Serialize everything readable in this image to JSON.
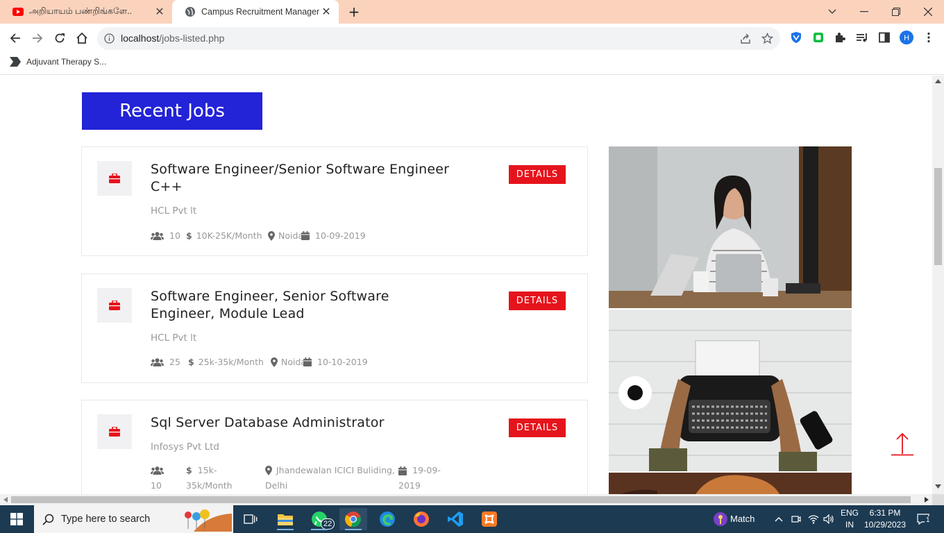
{
  "browser": {
    "tabs": [
      {
        "title": "அறியாயம் பண்றிங்களே..",
        "favicon": "youtube-icon",
        "active": false
      },
      {
        "title": "Campus Recruitment Management",
        "favicon": "globe-icon",
        "active": true
      }
    ],
    "new_tab": "+",
    "url_host": "localhost",
    "url_path": "/jobs-listed.php",
    "bookmark": "Adjuvant Therapy S..."
  },
  "page": {
    "heading": "Recent Jobs",
    "details_label": "DETAILS",
    "jobs": [
      {
        "title": "Software Engineer/Senior Software Engineer C++",
        "company": "HCL Pvt lt",
        "openings": "10",
        "salary": "10K-25K/Month",
        "location": "Noida",
        "date": "10-09-2019"
      },
      {
        "title": "Software Engineer, Senior Software Engineer, Module Lead",
        "company": "HCL Pvt lt",
        "openings": "25",
        "salary": "25k-35k/Month",
        "location": "Noida",
        "date": "10-10-2019"
      },
      {
        "title": "Sql Server Database Administrator",
        "company": "Infosys Pvt Ltd",
        "openings": "10",
        "salary_line1": "15k-",
        "salary_line2": "35k/Month",
        "location_line1": "Jhandewalan ICICI Buliding,",
        "location_line2": "Delhi",
        "date_line1": "19-09-",
        "date_line2": "2019"
      }
    ]
  },
  "taskbar": {
    "search_placeholder": "Type here to search",
    "whatsapp_badge": "22",
    "match_label": "Match",
    "lang_line1": "ENG",
    "lang_line2": "IN",
    "time": "6:31 PM",
    "date": "10/29/2023",
    "notifications": "1"
  },
  "colors": {
    "accent_blue": "#2323d8",
    "details_red": "#e5141c",
    "tabstrip": "#fbd3bd",
    "taskbar": "#1c3a52"
  }
}
